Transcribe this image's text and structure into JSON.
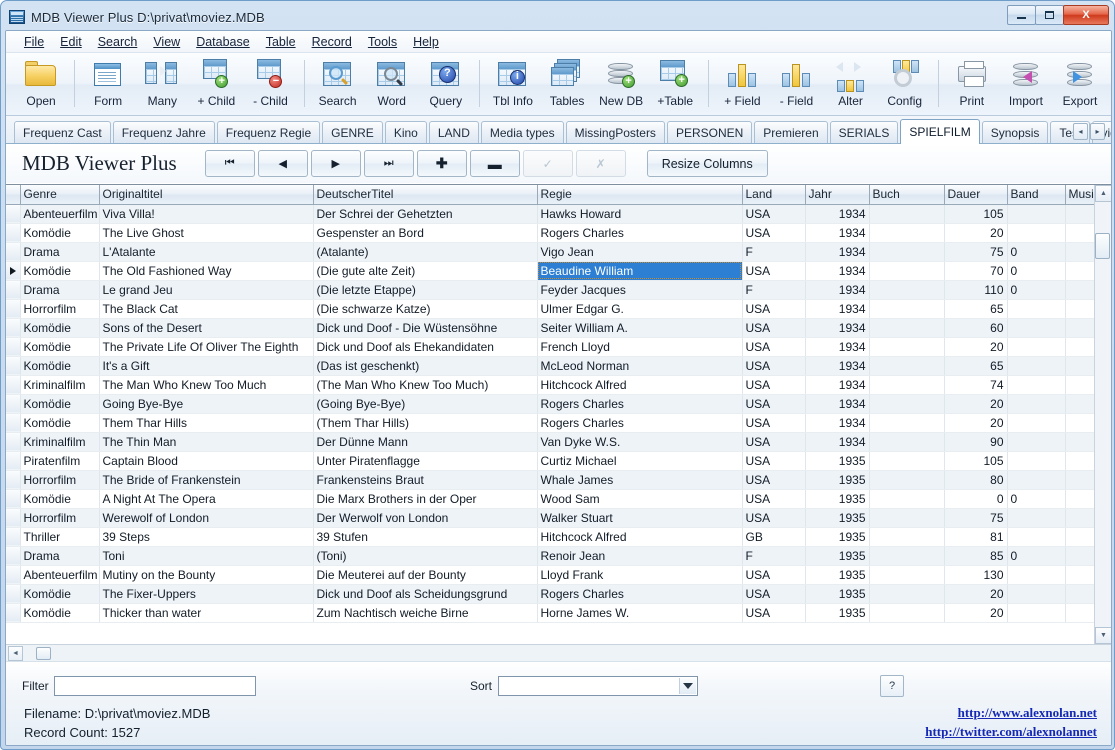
{
  "window": {
    "title": "MDB Viewer Plus D:\\privat\\moviez.MDB",
    "minimize": "–",
    "maximize": "□",
    "close": "X"
  },
  "menubar": [
    "File",
    "Edit",
    "Search",
    "View",
    "Database",
    "Table",
    "Record",
    "Tools",
    "Help"
  ],
  "toolbar": [
    {
      "label": "Open",
      "icon": "folder-open-icon"
    },
    {
      "sep": true
    },
    {
      "label": "Form",
      "icon": "form-window-icon"
    },
    {
      "label": "Many",
      "icon": "many-relations-icon"
    },
    {
      "label": "+ Child",
      "icon": "add-child-icon"
    },
    {
      "label": "- Child",
      "icon": "remove-child-icon"
    },
    {
      "sep": true
    },
    {
      "label": "Search",
      "icon": "search-table-icon"
    },
    {
      "label": "Word",
      "icon": "word-search-icon"
    },
    {
      "label": "Query",
      "icon": "query-icon"
    },
    {
      "sep": true
    },
    {
      "label": "Tbl Info",
      "icon": "table-info-icon"
    },
    {
      "label": "Tables",
      "icon": "tables-icon"
    },
    {
      "label": "New DB",
      "icon": "new-database-icon"
    },
    {
      "label": "+Table",
      "icon": "add-table-icon"
    },
    {
      "sep": true
    },
    {
      "label": "+ Field",
      "icon": "add-field-icon"
    },
    {
      "label": "- Field",
      "icon": "remove-field-icon"
    },
    {
      "label": "Alter",
      "icon": "alter-field-icon"
    },
    {
      "label": "Config",
      "icon": "config-gear-icon"
    },
    {
      "sep": true
    },
    {
      "label": "Print",
      "icon": "printer-icon"
    },
    {
      "label": "Import",
      "icon": "import-icon"
    },
    {
      "label": "Export",
      "icon": "export-icon"
    }
  ],
  "tabs": {
    "items": [
      "Frequenz Cast",
      "Frequenz Jahre",
      "Frequenz Regie",
      "GENRE",
      "Kino",
      "LAND",
      "Media types",
      "MissingPosters",
      "PERSONEN",
      "Premieren",
      "SERIALS",
      "SPIELFILM",
      "Synopsis",
      "Test",
      "videoclips"
    ],
    "active": "SPIELFILM",
    "scroll_left": "◂",
    "scroll_right": "▸"
  },
  "data_toolbar": {
    "brand": "MDB Viewer Plus",
    "nav": [
      {
        "name": "first-record-button",
        "glyph": "⏮",
        "disabled": false
      },
      {
        "name": "previous-record-button",
        "glyph": "◀",
        "disabled": false
      },
      {
        "name": "next-record-button",
        "glyph": "▶",
        "disabled": false
      },
      {
        "name": "last-record-button",
        "glyph": "⏭",
        "disabled": false
      },
      {
        "name": "insert-record-button",
        "glyph": "➕",
        "disabled": false
      },
      {
        "name": "delete-record-button",
        "glyph": "➖",
        "disabled": false
      },
      {
        "name": "edit-record-button",
        "glyph": "✓",
        "disabled": true
      },
      {
        "name": "cancel-edit-button",
        "glyph": "✗",
        "disabled": true
      }
    ],
    "resize_columns": "Resize Columns"
  },
  "grid": {
    "columns": [
      "Genre",
      "Originaltitel",
      "DeutscherTitel",
      "Regie",
      "Land",
      "Jahr",
      "Buch",
      "Dauer",
      "Band",
      "Musik"
    ],
    "selected_cell": {
      "row": 3,
      "column": "Regie",
      "value": "Beaudine William"
    },
    "current_row_index": 3,
    "rows": [
      [
        "Abenteuerfilm",
        "Viva Villa!",
        "Der Schrei der Gehetzten",
        "Hawks Howard",
        "USA",
        "1934",
        "",
        "105",
        "",
        ""
      ],
      [
        "Komödie",
        "The Live Ghost",
        "Gespenster an Bord",
        "Rogers Charles",
        "USA",
        "1934",
        "",
        "20",
        "",
        ""
      ],
      [
        "Drama",
        "L'Atalante",
        "(Atalante)",
        "Vigo Jean",
        "F",
        "1934",
        "",
        "75",
        "0",
        ""
      ],
      [
        "Komödie",
        "The Old Fashioned Way",
        "(Die gute alte Zeit)",
        "Beaudine William",
        "USA",
        "1934",
        "",
        "70",
        "0",
        ""
      ],
      [
        "Drama",
        "Le grand Jeu",
        "(Die letzte Etappe)",
        "Feyder Jacques",
        "F",
        "1934",
        "",
        "110",
        "0",
        ""
      ],
      [
        "Horrorfilm",
        "The Black Cat",
        "(Die schwarze Katze)",
        "Ulmer Edgar G.",
        "USA",
        "1934",
        "",
        "65",
        "",
        ""
      ],
      [
        "Komödie",
        "Sons of the Desert",
        "Dick und Doof - Die Wüstensöhne",
        "Seiter William A.",
        "USA",
        "1934",
        "",
        "60",
        "",
        ""
      ],
      [
        "Komödie",
        "The Private Life Of Oliver The Eighth",
        "Dick und Doof als Ehekandidaten",
        "French Lloyd",
        "USA",
        "1934",
        "",
        "20",
        "",
        ""
      ],
      [
        "Komödie",
        "It's a Gift",
        "(Das ist geschenkt)",
        "McLeod Norman",
        "USA",
        "1934",
        "",
        "65",
        "",
        ""
      ],
      [
        "Kriminalfilm",
        "The Man Who Knew Too Much",
        "(The Man Who Knew Too Much)",
        "Hitchcock Alfred",
        "USA",
        "1934",
        "",
        "74",
        "",
        ""
      ],
      [
        "Komödie",
        "Going Bye-Bye",
        "(Going Bye-Bye)",
        "Rogers Charles",
        "USA",
        "1934",
        "",
        "20",
        "",
        ""
      ],
      [
        "Komödie",
        "Them Thar Hills",
        "(Them Thar Hills)",
        "Rogers Charles",
        "USA",
        "1934",
        "",
        "20",
        "",
        ""
      ],
      [
        "Kriminalfilm",
        "The Thin Man",
        "Der Dünne Mann",
        "Van Dyke W.S.",
        "USA",
        "1934",
        "",
        "90",
        "",
        ""
      ],
      [
        "Piratenfilm",
        "Captain Blood",
        "Unter Piratenflagge",
        "Curtiz Michael",
        "USA",
        "1935",
        "",
        "105",
        "",
        ""
      ],
      [
        "Horrorfilm",
        "The Bride of Frankenstein",
        "Frankensteins Braut",
        "Whale James",
        "USA",
        "1935",
        "",
        "80",
        "",
        ""
      ],
      [
        "Komödie",
        "A Night At The Opera",
        "Die Marx Brothers in der Oper",
        "Wood Sam",
        "USA",
        "1935",
        "",
        "0",
        "0",
        ""
      ],
      [
        "Horrorfilm",
        "Werewolf of London",
        "Der Werwolf von London",
        "Walker Stuart",
        "USA",
        "1935",
        "",
        "75",
        "",
        ""
      ],
      [
        "Thriller",
        "39 Steps",
        "39 Stufen",
        "Hitchcock Alfred",
        "GB",
        "1935",
        "",
        "81",
        "",
        ""
      ],
      [
        "Drama",
        "Toni",
        "(Toni)",
        "Renoir Jean",
        "F",
        "1935",
        "",
        "85",
        "0",
        ""
      ],
      [
        "Abenteuerfilm",
        "Mutiny on the Bounty",
        "Die Meuterei auf der Bounty",
        "Lloyd Frank",
        "USA",
        "1935",
        "",
        "130",
        "",
        ""
      ],
      [
        "Komödie",
        "The Fixer-Uppers",
        "Dick und Doof als Scheidungsgrund",
        "Rogers Charles",
        "USA",
        "1935",
        "",
        "20",
        "",
        ""
      ],
      [
        "Komödie",
        "Thicker than water",
        "Zum Nachtisch weiche Birne",
        "Horne James W.",
        "USA",
        "1935",
        "",
        "20",
        "",
        ""
      ]
    ]
  },
  "footer": {
    "filter_label": "Filter",
    "filter_value": "",
    "sort_label": "Sort",
    "sort_value": "",
    "help_label": "?",
    "filename": "Filename: D:\\privat\\moviez.MDB",
    "record_count": "Record Count: 1527",
    "link_website": "http://www.alexnolan.net",
    "link_twitter": "http://twitter.com/alexnolannet"
  }
}
